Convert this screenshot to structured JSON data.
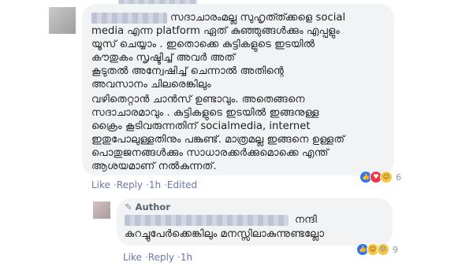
{
  "comment": {
    "lines": [
      "സദാചാരംമല്ല സുഹൃത്ത്ക്കളെ social",
      "media എന്ന platform ഏത് കുഞ്ഞുങ്ങൾക്കും എപ്പളും",
      "യൂസ് ചെയ്യാം . ഇതൊക്കെ കുട്ടികളുടെ ഇടയിൽ",
      "കൗതുകം സൃഷ്ടിച്ച് അവർ അത്",
      "കൂടുതൽ അന്വേഷിച്ച് ചെന്നാൽ അതിന്റെ",
      "അവസാനം ചിലരെങ്കിലും",
      "വഴിതെറ്റാൻ ചാൻസ് ഉണ്ടാവും. അതെങ്ങനെ",
      "സദാചാരമാവും . കുട്ടികളുടെ ഇടയിൽ ഇങ്ങനുള്ള",
      "ക്രൈം കൂടിവരുന്നതിന് socialmedia, internet",
      "ഇതുപോലുള്ളതിനും പങ്കുണ്ട്. മാത്രമല്ല ഇങ്ങനെ ഉള്ളത്",
      "പൊതുജനങ്ങൾക്കും സാധാരക്കർക്കുമൊക്കെ എന്ത്",
      "ആശയമാണ് നൽകുന്നത്."
    ],
    "actions": {
      "like": "Like",
      "reply": "Reply",
      "time": "1h",
      "edited": "Edited"
    },
    "reaction_count": "6",
    "reaction_icons": [
      "like-icon",
      "love-icon",
      "haha-icon"
    ]
  },
  "reply": {
    "author_badge": "Author",
    "first_line_suffix": "നന്ദി",
    "second_line": "കുറച്ചുപേർക്കെങ്കിലും മനസ്സിലാകുന്നുണ്ടല്ലോ",
    "actions": {
      "like": "Like",
      "reply": "Reply",
      "time": "1h"
    },
    "reaction_count": "9",
    "reaction_icons": [
      "like-icon",
      "haha-icon",
      "cry-icon"
    ]
  },
  "colors": {
    "bubble": "#f2f3f5",
    "link": "#6b76a6",
    "meta": "#90949c",
    "like": "#2d74f5",
    "love": "#f2344d"
  }
}
